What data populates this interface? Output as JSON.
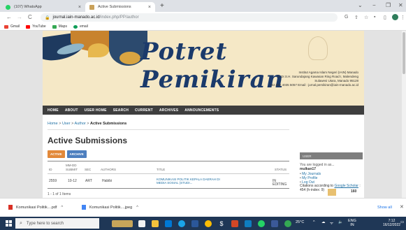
{
  "browser": {
    "tabs": [
      {
        "title": "(107) WhatsApp",
        "active": false
      },
      {
        "title": "Active Submissions",
        "active": true
      }
    ],
    "new_tab": "+",
    "window_controls": [
      "⌄",
      "−",
      "❐",
      "✕"
    ],
    "nav": {
      "back": "←",
      "forward": "→",
      "reload": "C"
    },
    "url_host": "journal.iain-manado.ac.id",
    "url_path": "/index.php/PP/author",
    "bookmarks": [
      {
        "label": "Gmail",
        "color": "#ea4335"
      },
      {
        "label": "YouTube",
        "color": "#ff0000"
      },
      {
        "label": "Maps",
        "color": "#34a853"
      },
      {
        "label": "email",
        "color": "#0f9d58"
      }
    ]
  },
  "banner": {
    "title": "Potret Pemikiran",
    "address_lines": [
      "Institut Agama Islam Negeri (IAIN) Manado",
      "Jl. Dr.S.H. Sarundajang Kawasan Ring Road I, Malendeng",
      "Sulawesi Utara, Manado 95128",
      "+62.852 4035 5057  Email : jurnal.pemikiran@iain-manado.ac.id"
    ]
  },
  "navbar": [
    "HOME",
    "ABOUT",
    "USER HOME",
    "SEARCH",
    "CURRENT",
    "ARCHIVES",
    "ANNOUNCEMENTS"
  ],
  "breadcrumb": {
    "home": "Home",
    "user": "User",
    "author": "Author",
    "current": "Active Submissions"
  },
  "page_title": "Active Submissions",
  "buttons": {
    "active": "ACTIVE",
    "archive": "ARCHIVE"
  },
  "table": {
    "headers": {
      "id": "ID",
      "submit_1": "MM-DD",
      "submit_2": "SUBMIT",
      "sec": "SEC",
      "authors": "AUTHORS",
      "title": "TITLE",
      "status": "STATUS"
    },
    "row": {
      "id": "2559",
      "submit": "10-12",
      "sec": "ART",
      "authors": "Habibi",
      "title_1": "KOMUNIKASI POLITIK KEPALA DAERAH DI",
      "title_2": "MEDIA SOSIAL (STUDI...",
      "status": "IN EDITING"
    },
    "items_text": "1 - 1 of 1 Items"
  },
  "sidebar": {
    "header": "USER",
    "logged_as": "You are logged in as...",
    "username": "mulkan17",
    "links": [
      "My Journals",
      "My Profile",
      "Log Out"
    ],
    "citations_prefix": "Citations according to",
    "citations_link": "Google Scholar",
    "citations_suffix": ": 454 (h-index: 9)",
    "counter": "160"
  },
  "downloads": [
    {
      "name": "Komunikasi Politik....pdf",
      "color": "#d93025"
    },
    {
      "name": "Komunikasi Politik....jpeg",
      "color": "#4285f4"
    }
  ],
  "downloads_show_all": "Show all",
  "taskbar": {
    "search_placeholder": "Type here to search",
    "weather": "25°C",
    "lang": "ENG",
    "lang2": "IN",
    "time": "7:12",
    "date": "16/12/2022"
  }
}
